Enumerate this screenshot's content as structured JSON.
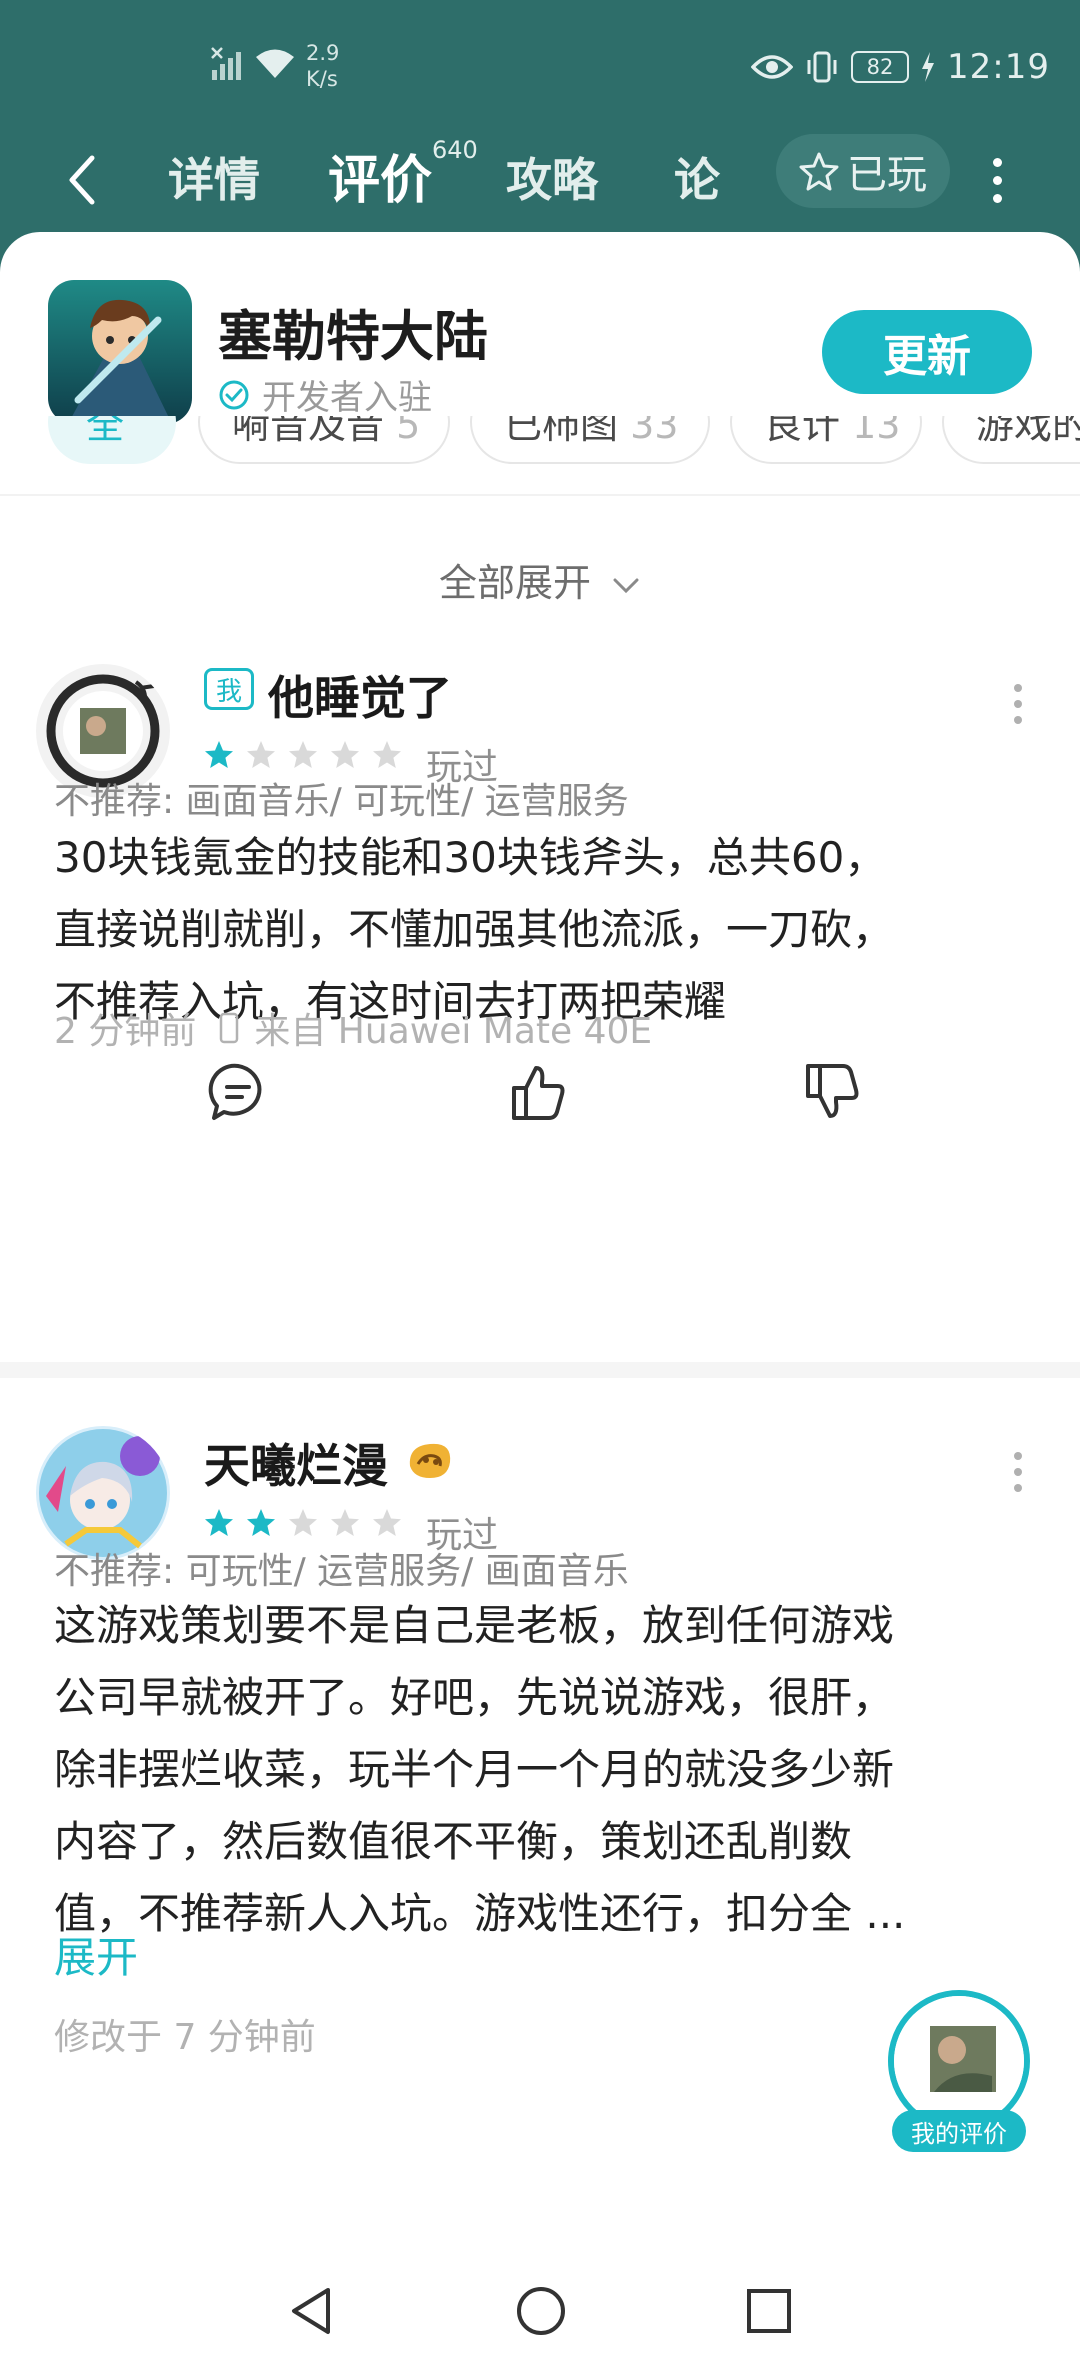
{
  "status_bar": {
    "net_speed_value": "2.9",
    "net_speed_unit": "K/s",
    "battery": "82",
    "time": "12:19"
  },
  "nav": {
    "tabs": [
      {
        "label": "详情"
      },
      {
        "label": "评价"
      },
      {
        "label": "攻略"
      },
      {
        "label": "论坛"
      }
    ],
    "review_count": "640",
    "played_label": "已玩"
  },
  "game": {
    "name": "塞勒特大陆",
    "developer_label": "开发者入驻",
    "update_label": "更新"
  },
  "filter_tags": [
    {
      "label": "全",
      "count": ""
    },
    {
      "label": "嗬音及音",
      "count": "5"
    },
    {
      "label": "已柿图",
      "count": "33"
    },
    {
      "label": "良计",
      "count": "13"
    },
    {
      "label": "游戏的",
      "count": ""
    }
  ],
  "expand_all_label": "全部展开",
  "reviews": [
    {
      "me_badge": "我",
      "username": "他睡觉了",
      "rating": 1,
      "played": "玩过",
      "not_recommended": "不推荐: 画面音乐/ 可玩性/ 运营服务",
      "lines": [
        "30块钱氪金的技能和30块钱斧头，总共60，",
        "直接说削就削，不懂加强其他流派，一刀砍，",
        "不推荐入坑，有这时间去打两把荣耀"
      ],
      "time": "2 分钟前",
      "device": "来自 Huawei Mate 40E"
    },
    {
      "username": "天曦烂漫",
      "rating": 2,
      "played": "玩过",
      "not_recommended": "不推荐: 可玩性/ 运营服务/ 画面音乐",
      "lines": [
        "这游戏策划要不是自己是老板，放到任何游戏",
        "公司早就被开了。好吧，先说说游戏，很肝，",
        "除非摆烂收菜，玩半个月一个月的就没多少新",
        "内容了，然后数值很不平衡，策划还乱削数",
        "值，不推荐新人入坑。游戏性还行，扣分全 ..."
      ],
      "expand_label": "展开",
      "time": "修改于 7 分钟前"
    }
  ],
  "my_review_label": "我的评价",
  "colors": {
    "header": "#2e6e6a",
    "accent": "#1cb9c6",
    "star_off": "#d9d9d9"
  }
}
